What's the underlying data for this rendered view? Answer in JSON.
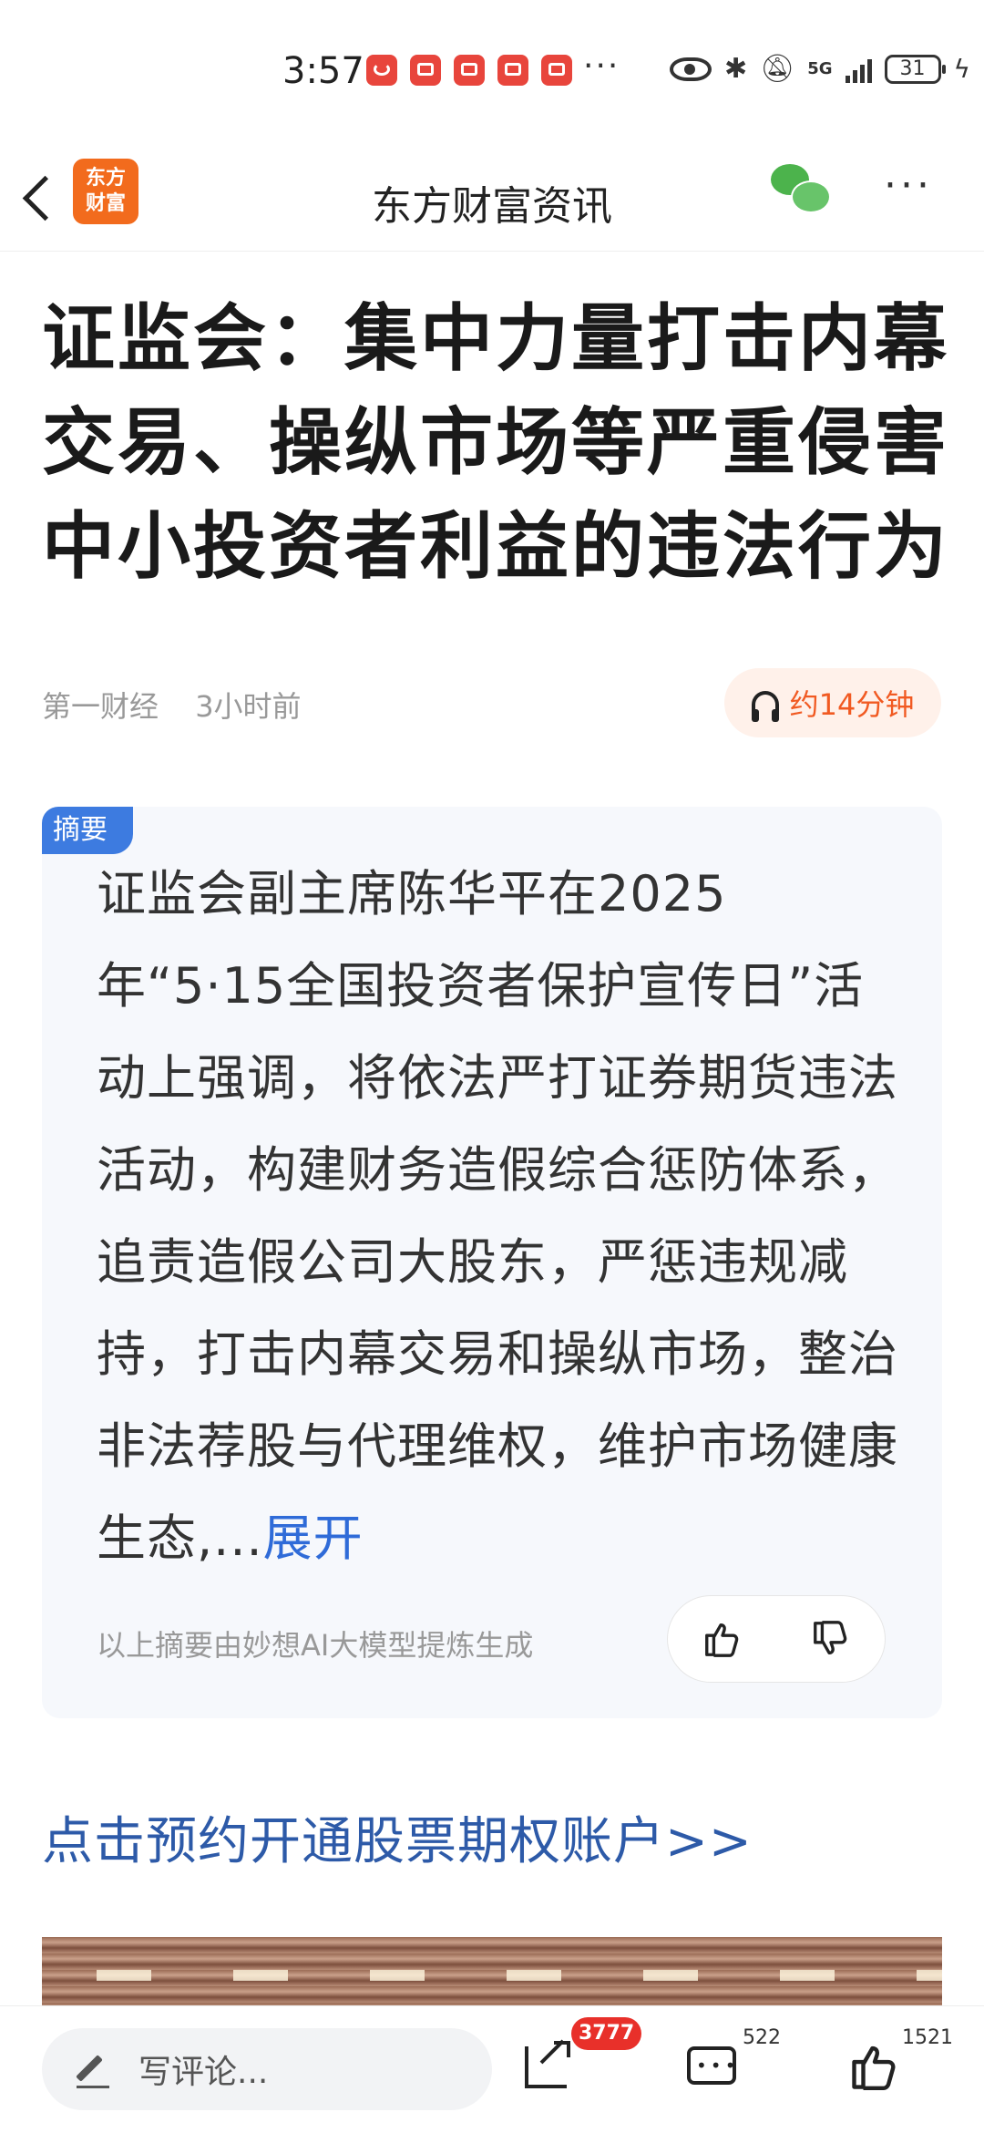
{
  "status_bar": {
    "time": "3:57",
    "network": "5G",
    "battery": "31",
    "more_notifications": "···"
  },
  "header": {
    "logo_line1": "东方",
    "logo_line2": "财富",
    "title": "东方财富资讯",
    "more": "···"
  },
  "article": {
    "title": "证监会：集中力量打击内幕交易、操纵市场等严重侵害中小投资者利益的违法行为",
    "source": "第一财经",
    "time_ago": "3小时前",
    "audio_duration": "约14分钟"
  },
  "summary": {
    "tag": "摘要",
    "text": "证监会副主席陈华平在2025年“5·15全国投资者保护宣传日”活动上强调，将依法严打证券期货违法活动，构建财务造假综合惩防体系，追责造假公司大股东，严惩违规减持，打击内幕交易和操纵市场，整治非法荐股与代理维权，维护市场健康生态,...",
    "expand_label": "展开",
    "note": "以上摘要由妙想AI大模型提炼生成"
  },
  "promo": {
    "link_text": "点击预约开通股票期权账户>>"
  },
  "bottom_bar": {
    "comment_placeholder": "写评论...",
    "share_count": "3777",
    "comment_count": "522",
    "like_count": "1521"
  },
  "colors": {
    "brand_orange": "#f26b1d",
    "link_blue": "#2d5aa8",
    "summary_tag_blue": "#3d7be0",
    "badge_red": "#e8302a"
  }
}
